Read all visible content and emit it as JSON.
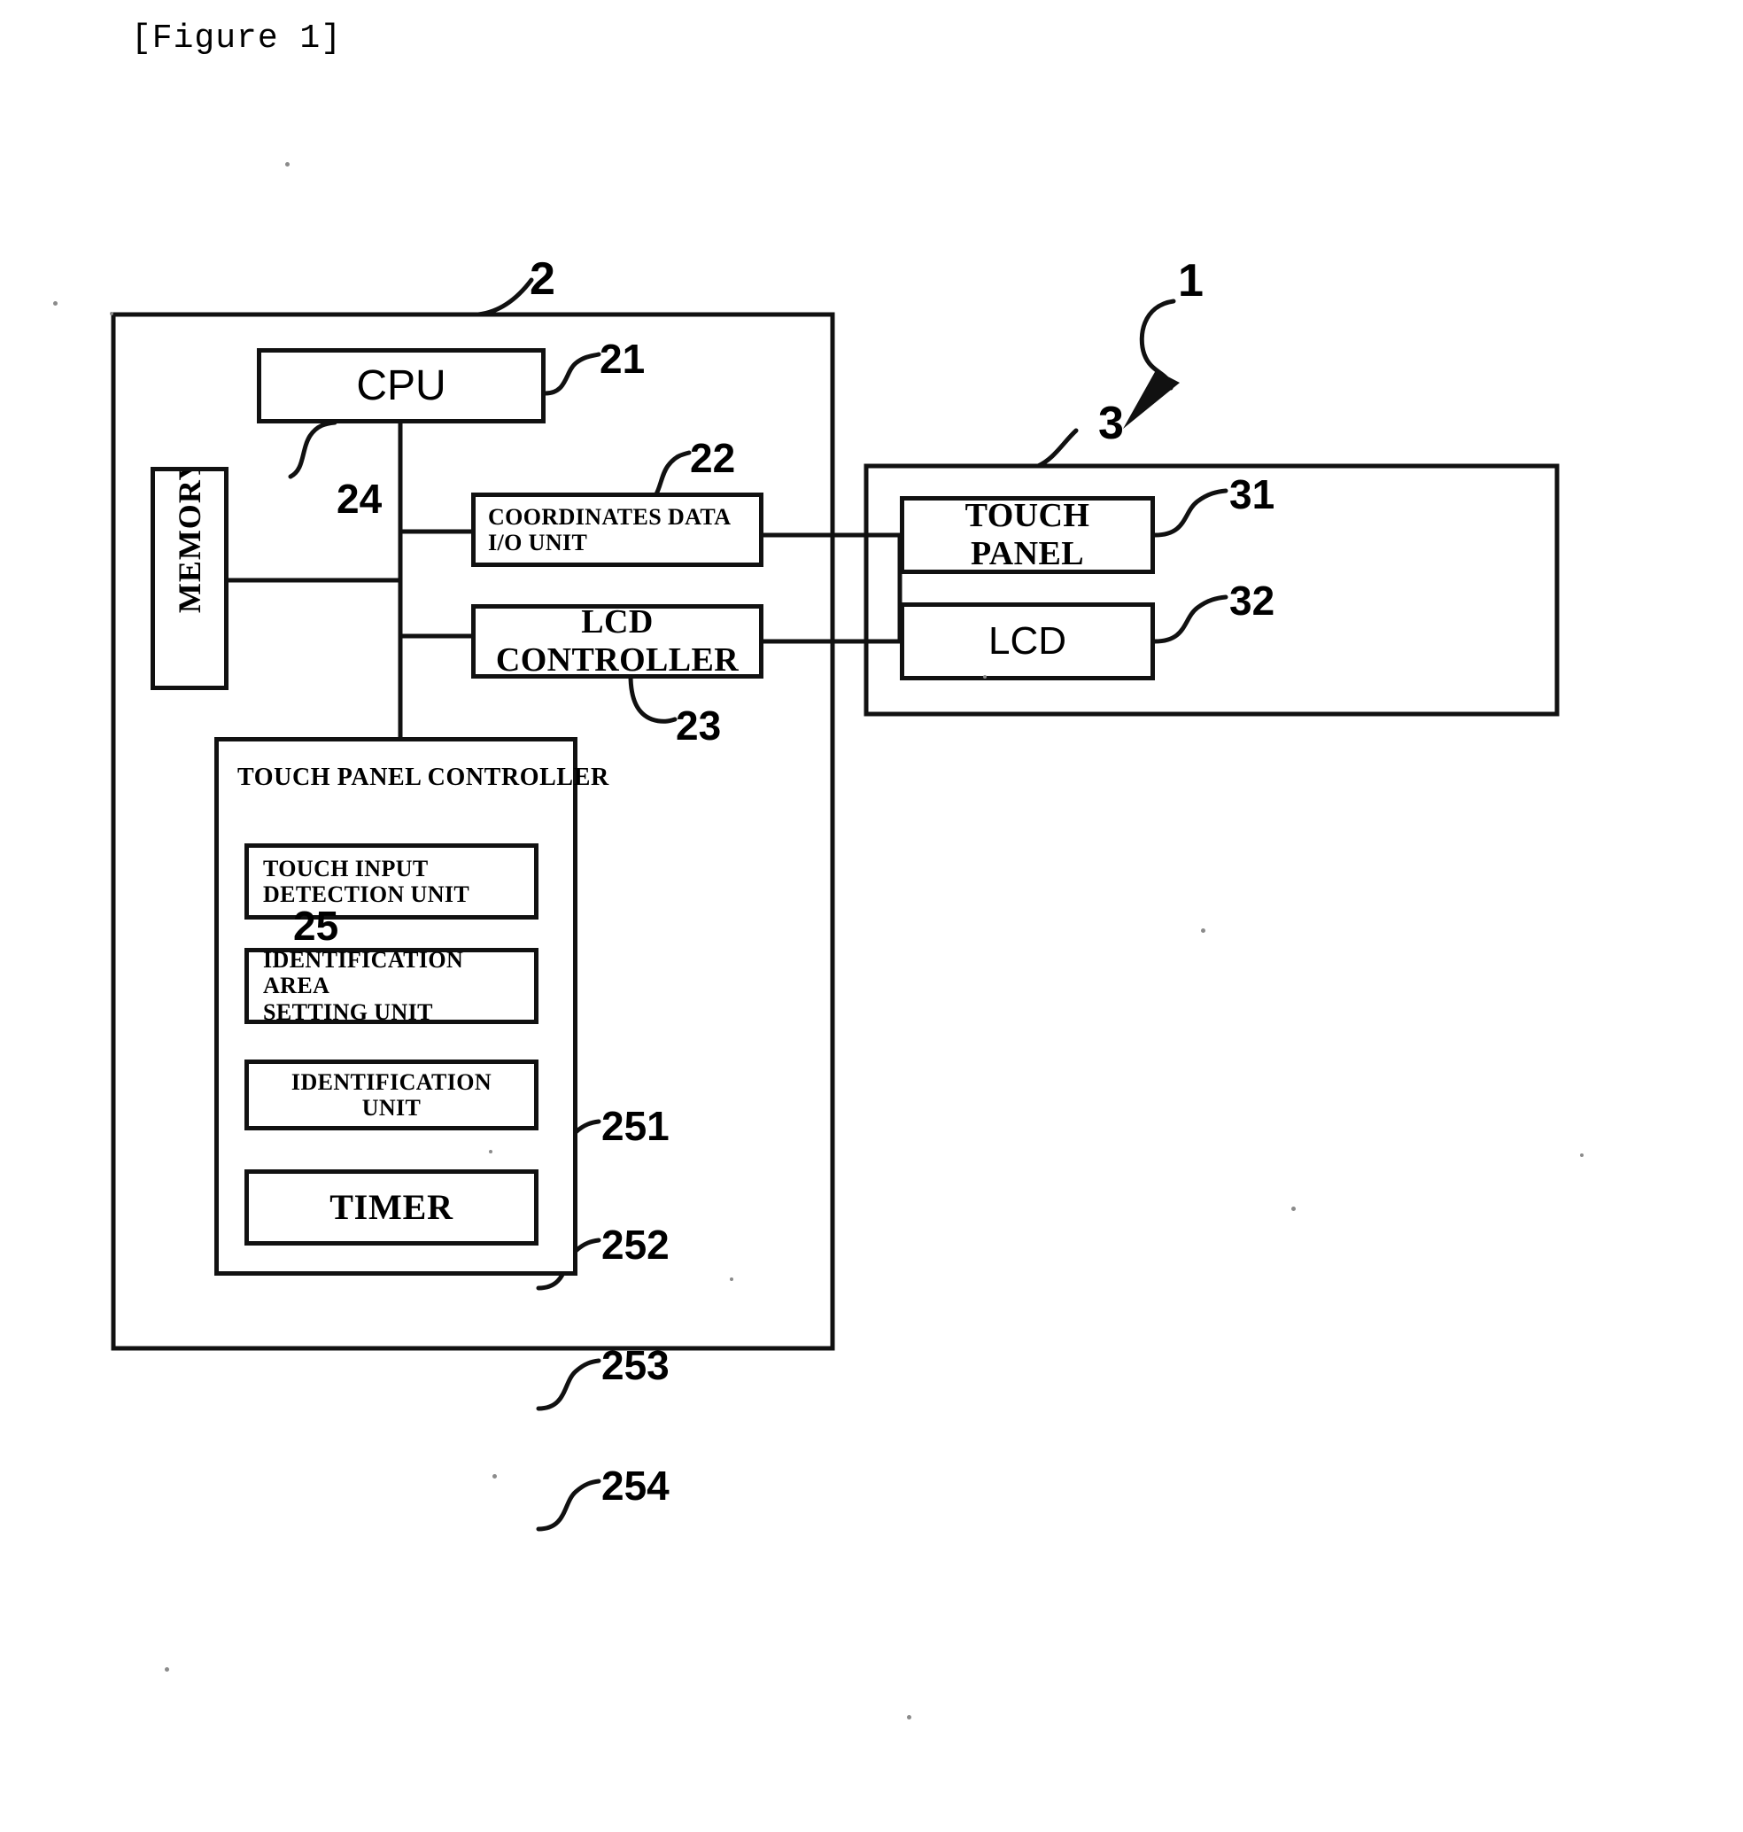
{
  "figure": {
    "title": "[Figure 1]"
  },
  "blocks": {
    "cpu": "CPU",
    "memory": "MEMORY",
    "coordinates_io": "COORDINATES DATA\nI/O UNIT",
    "coordinates_io_line1": "COORDINATES DATA",
    "coordinates_io_line2": "I/O UNIT",
    "lcd_controller": "LCD CONTROLLER",
    "touch_panel_controller": "TOUCH PANEL CONTROLLER",
    "touch_input_detection_line1": "TOUCH INPUT",
    "touch_input_detection_line2": "DETECTION UNIT",
    "identification_area_line1": "IDENTIFICATION AREA",
    "identification_area_line2": "SETTING UNIT",
    "identification_unit": "IDENTIFICATION UNIT",
    "timer": "TIMER",
    "touch_panel": "TOUCH PANEL",
    "lcd": "LCD"
  },
  "reference_numerals": {
    "device": "1",
    "main_unit": "2",
    "display_unit": "3",
    "cpu": "21",
    "coordinates_io": "22",
    "lcd_controller": "23",
    "memory": "24",
    "touch_panel_controller": "25",
    "touch_input_detection_unit": "251",
    "identification_area_setting_unit": "252",
    "identification_unit": "253",
    "timer": "254",
    "touch_panel": "31",
    "lcd": "32"
  },
  "colors": {
    "ink": "#111111",
    "paper": "#ffffff",
    "speck": "#8b8b8b"
  }
}
